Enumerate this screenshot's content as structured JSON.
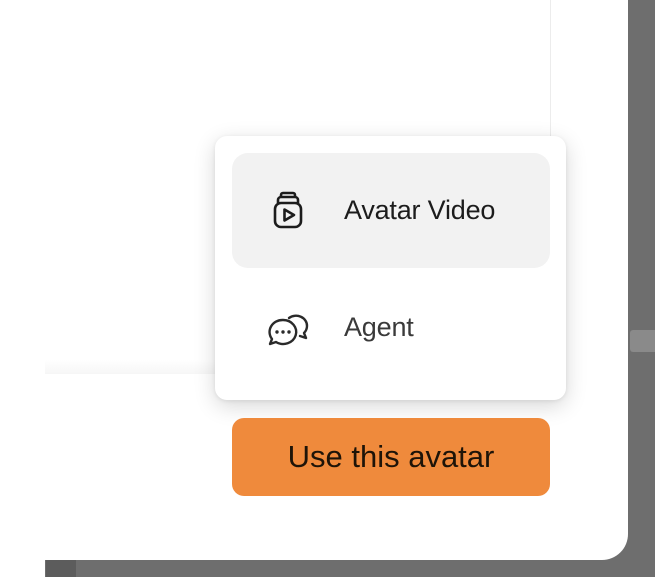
{
  "menu": {
    "items": [
      {
        "label": "Avatar Video",
        "icon": "video-stack-icon",
        "selected": true
      },
      {
        "label": "Agent",
        "icon": "chat-bubbles-icon",
        "selected": false
      }
    ]
  },
  "actions": {
    "primary_label": "Use this avatar"
  },
  "colors": {
    "accent": "#ef8a3c",
    "menu_highlight": "#f2f2f2",
    "backdrop": "#6e6e6e"
  }
}
